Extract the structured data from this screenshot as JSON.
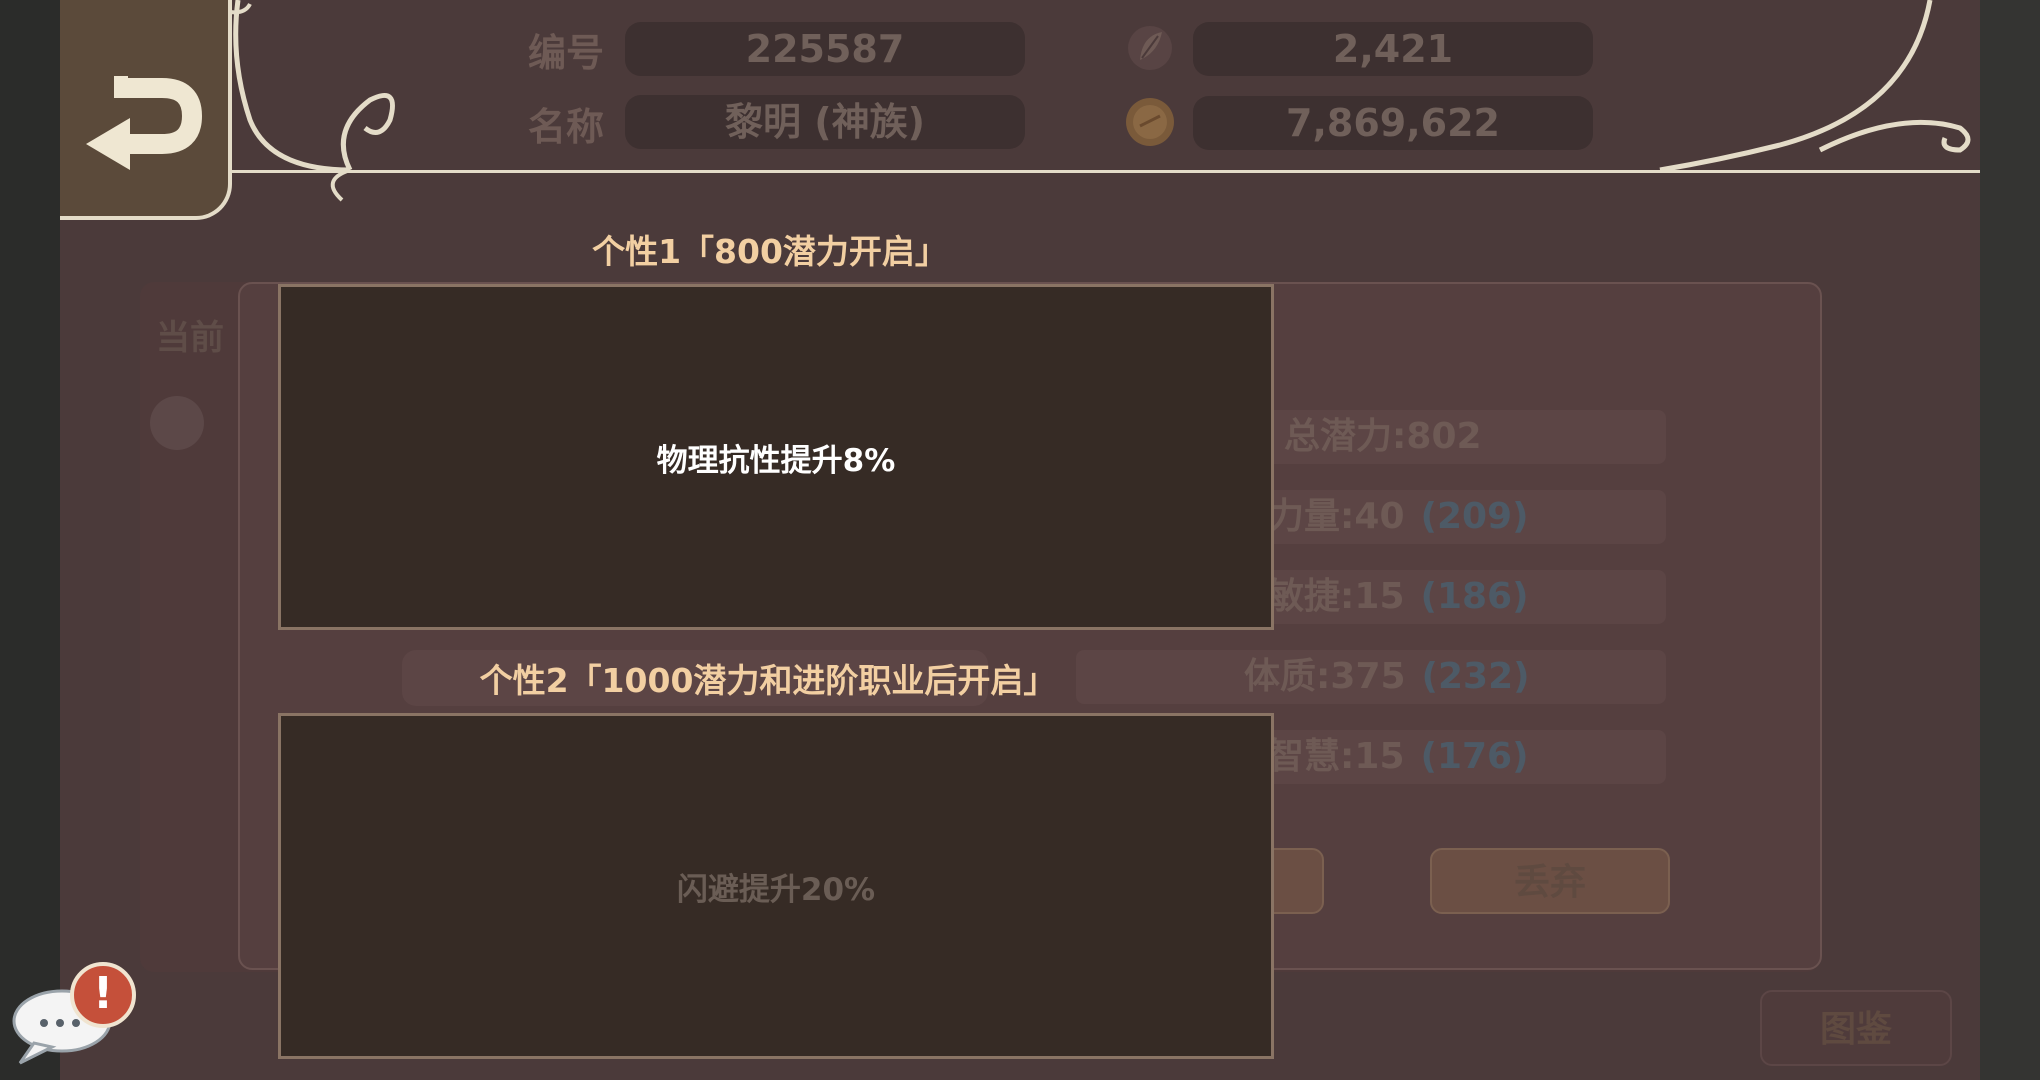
{
  "header": {
    "id_label": "编号",
    "id_value": "225587",
    "name_label": "名称",
    "name_value": "黎明 (神族)",
    "currency1_icon": "feather-scroll-icon",
    "currency1_value": "2,421",
    "currency2_icon": "gold-coin-icon",
    "currency2_value": "7,869,622"
  },
  "background": {
    "current_label_partial": "当前",
    "stats": [
      {
        "label": "总潜力:802",
        "bonus": ""
      },
      {
        "label": "力量:40",
        "bonus": "(209)"
      },
      {
        "label": "敏捷:15",
        "bonus": "(186)"
      },
      {
        "label": "体质:375",
        "bonus": "(232)"
      },
      {
        "label": "智慧:15",
        "bonus": "(176)"
      }
    ],
    "discard_button": "丢弃",
    "codex_button": "图鉴"
  },
  "traits": [
    {
      "title": "个性1「800潜力开启」",
      "description": "物理抗性提升8%",
      "active": true
    },
    {
      "title": "个性2「1000潜力和进阶职业后开启」",
      "description": "闪避提升20%",
      "active": false
    }
  ],
  "chat": {
    "icon": "chat-bubble-icon",
    "alert_icon": "exclamation-icon",
    "alert_glyph": "!"
  }
}
